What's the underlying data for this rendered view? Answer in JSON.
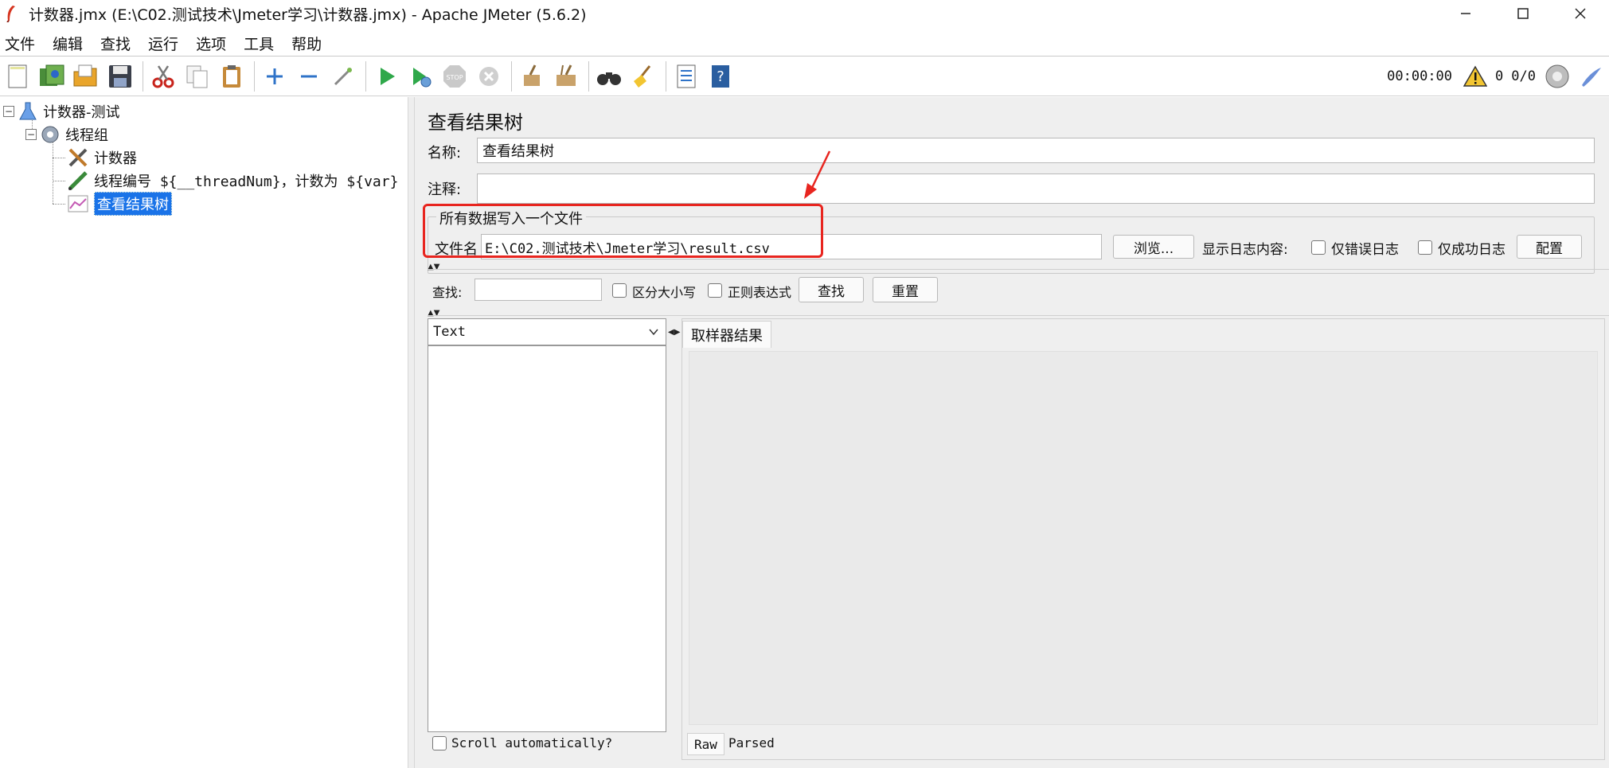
{
  "window": {
    "title": "计数器.jmx (E:\\C02.测试技术\\Jmeter学习\\计数器.jmx) - Apache JMeter (5.6.2)"
  },
  "menu": [
    "文件",
    "编辑",
    "查找",
    "运行",
    "选项",
    "工具",
    "帮助"
  ],
  "toolbar": {
    "timer": "00:00:00",
    "warnings": "0",
    "threads": "0/0"
  },
  "tree": {
    "root": "计数器-测试",
    "thread_group": "线程组",
    "items": [
      "计数器",
      "线程编号 ${__threadNum}，计数为 ${var}",
      "查看结果树"
    ]
  },
  "panel": {
    "title": "查看结果树",
    "name_label": "名称:",
    "name_value": "查看结果树",
    "comment_label": "注释:",
    "comment_value": "",
    "file_group_legend": "所有数据写入一个文件",
    "file_label": "文件名",
    "file_value": "E:\\C02.测试技术\\Jmeter学习\\result.csv",
    "browse": "浏览...",
    "log_content_label": "显示日志内容:",
    "errors_only": "仅错误日志",
    "success_only": "仅成功日志",
    "configure": "配置"
  },
  "search": {
    "label": "查找:",
    "value": "",
    "case_sensitive": "区分大小写",
    "regex": "正则表达式",
    "find_button": "查找",
    "reset_button": "重置"
  },
  "results": {
    "renderer": "Text",
    "scroll_auto": "Scroll automatically?",
    "tab": "取样器结果",
    "bottom_tabs": [
      "Raw",
      "Parsed"
    ]
  },
  "colors": {
    "selection": "#1a73e8",
    "annotation": "#e8251f"
  }
}
